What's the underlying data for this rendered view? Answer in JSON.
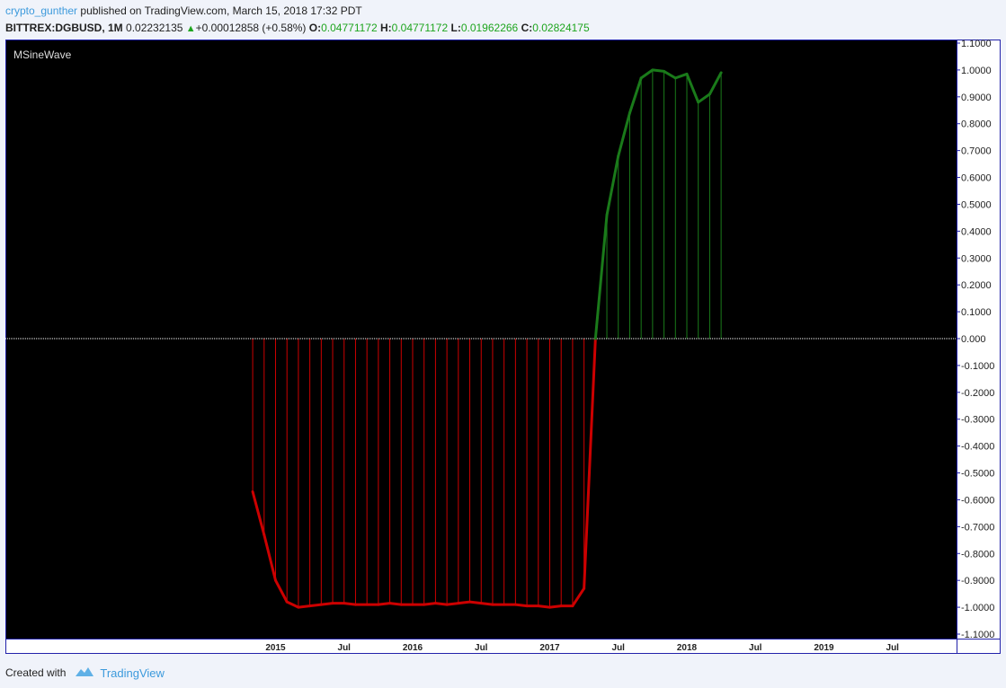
{
  "header": {
    "author": "crypto_gunther",
    "published_text": "published on TradingView.com, March 15, 2018 17:32 PDT",
    "symbol": "BITTREX:DGBUSD, 1M",
    "last_price": "0.02232135",
    "change": "+0.00012858 (+0.58%)",
    "o_label": "O:",
    "o_value": "0.04771172",
    "h_label": "H:",
    "h_value": "0.04771172",
    "l_label": "L:",
    "l_value": "0.01962266",
    "c_label": "C:",
    "c_value": "0.02824175",
    "up_arrow_icon": "up-triangle-icon"
  },
  "footer": {
    "created_with": "Created with",
    "brand": "TradingView",
    "logo_icon": "tradingview-cloud-icon"
  },
  "chart_data": {
    "type": "line",
    "title": "MSineWave",
    "ylim": [
      -1.1,
      1.1
    ],
    "y_ticks": [
      1.1,
      1.0,
      0.9,
      0.8,
      0.7,
      0.6,
      0.5,
      0.4,
      0.3,
      0.2,
      0.1,
      0.0,
      -0.1,
      -0.2,
      -0.3,
      -0.4,
      -0.5,
      -0.6,
      -0.7,
      -0.8,
      -0.9,
      -1.0,
      -1.1
    ],
    "y_tick_labels": [
      "1.1000",
      "1.0000",
      "0.9000",
      "0.8000",
      "0.7000",
      "0.6000",
      "0.5000",
      "0.4000",
      "0.3000",
      "0.2000",
      "0.1000",
      "0.000",
      "-0.1000",
      "-0.2000",
      "-0.3000",
      "-0.4000",
      "-0.5000",
      "-0.6000",
      "-0.7000",
      "-0.8000",
      "-0.9000",
      "-1.0000",
      "-1.1000"
    ],
    "x_tick_labels": [
      "2015",
      "Jul",
      "2016",
      "Jul",
      "2017",
      "Jul",
      "2018",
      "Jul",
      "2019",
      "Jul"
    ],
    "x_ticks_month_index": [
      0,
      6,
      12,
      18,
      24,
      30,
      36,
      42,
      48,
      54
    ],
    "x_month_range": [
      -11,
      61
    ],
    "x_label_note": "monthly bars, index 0 = 2015-01",
    "grid": false,
    "background": "#000000",
    "colors": {
      "negative": "#cc0000",
      "positive": "#1a7a1a",
      "zero_line": "#ffffff",
      "axis": "#2222aa"
    },
    "series": [
      {
        "values": [
          [
            -2,
            -0.57
          ],
          [
            -1,
            -0.73
          ],
          [
            0,
            -0.9
          ],
          [
            1,
            -0.98
          ],
          [
            2,
            -1.0
          ],
          [
            3,
            -0.995
          ],
          [
            4,
            -0.99
          ],
          [
            5,
            -0.985
          ],
          [
            6,
            -0.985
          ],
          [
            7,
            -0.99
          ],
          [
            8,
            -0.99
          ],
          [
            9,
            -0.99
          ],
          [
            10,
            -0.985
          ],
          [
            11,
            -0.99
          ],
          [
            12,
            -0.99
          ],
          [
            13,
            -0.99
          ],
          [
            14,
            -0.985
          ],
          [
            15,
            -0.99
          ],
          [
            16,
            -0.985
          ],
          [
            17,
            -0.98
          ],
          [
            18,
            -0.985
          ],
          [
            19,
            -0.99
          ],
          [
            20,
            -0.99
          ],
          [
            21,
            -0.99
          ],
          [
            22,
            -0.995
          ],
          [
            23,
            -0.995
          ],
          [
            24,
            -1.0
          ],
          [
            25,
            -0.995
          ],
          [
            26,
            -0.995
          ],
          [
            27,
            -0.93
          ],
          [
            28,
            0.0
          ],
          [
            29,
            0.46
          ],
          [
            30,
            0.68
          ],
          [
            31,
            0.84
          ],
          [
            32,
            0.97
          ],
          [
            33,
            1.0
          ],
          [
            34,
            0.995
          ],
          [
            35,
            0.97
          ],
          [
            36,
            0.985
          ],
          [
            37,
            0.88
          ],
          [
            38,
            0.91
          ],
          [
            39,
            0.99
          ]
        ]
      }
    ]
  }
}
